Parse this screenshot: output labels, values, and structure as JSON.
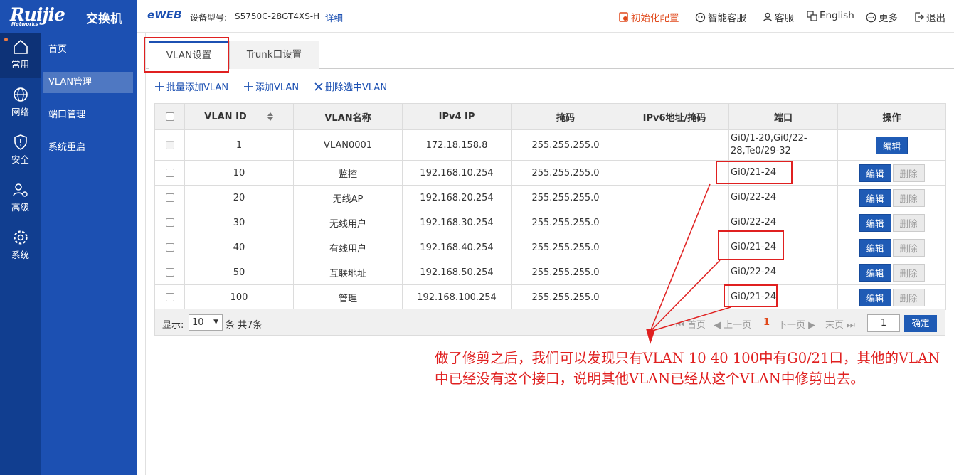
{
  "brand": {
    "logo": "Ruijie",
    "logo_sub": "Networks",
    "title": "交换机"
  },
  "header": {
    "eweb": "eWEB",
    "model_label": "设备型号:",
    "model_value": "S5750C-28GT4XS-H",
    "detail_link": "详细",
    "actions": [
      {
        "label": "初始化配置",
        "icon": "reset-icon",
        "color": "#e0491b"
      },
      {
        "label": "智能客服",
        "icon": "robot-icon"
      },
      {
        "label": "客服",
        "icon": "user-icon"
      },
      {
        "label": "English",
        "icon": "translate-icon"
      },
      {
        "label": "更多",
        "icon": "more-icon"
      },
      {
        "label": "退出",
        "icon": "logout-icon"
      }
    ]
  },
  "rail": {
    "items": [
      {
        "label": "常用",
        "icon": "home-icon"
      },
      {
        "label": "网络",
        "icon": "globe-icon"
      },
      {
        "label": "安全",
        "icon": "shield-icon"
      },
      {
        "label": "高级",
        "icon": "advanced-user-icon"
      },
      {
        "label": "系统",
        "icon": "gear-icon"
      }
    ]
  },
  "subnav": {
    "items": [
      {
        "label": "首页"
      },
      {
        "label": "VLAN管理"
      },
      {
        "label": "端口管理"
      },
      {
        "label": "系统重启"
      }
    ]
  },
  "tabs": [
    {
      "label": "VLAN设置"
    },
    {
      "label": "Trunk口设置"
    }
  ],
  "toolbar": {
    "batch_add": "批量添加VLAN",
    "add": "添加VLAN",
    "delete_selected": "删除选中VLAN"
  },
  "table": {
    "headers": [
      "VLAN ID",
      "VLAN名称",
      "IPv4 IP",
      "掩码",
      "IPv6地址/掩码",
      "端口",
      "操作"
    ],
    "rows": [
      {
        "id": "1",
        "name": "VLAN0001",
        "ip": "172.18.158.8",
        "mask": "255.255.255.0",
        "ipv6": "",
        "ports": "Gi0/1-20,Gi0/22-28,Te0/29-32"
      },
      {
        "id": "10",
        "name": "监控",
        "ip": "192.168.10.254",
        "mask": "255.255.255.0",
        "ipv6": "",
        "ports": "Gi0/21-24"
      },
      {
        "id": "20",
        "name": "无线AP",
        "ip": "192.168.20.254",
        "mask": "255.255.255.0",
        "ipv6": "",
        "ports": "Gi0/22-24"
      },
      {
        "id": "30",
        "name": "无线用户",
        "ip": "192.168.30.254",
        "mask": "255.255.255.0",
        "ipv6": "",
        "ports": "Gi0/22-24"
      },
      {
        "id": "40",
        "name": "有线用户",
        "ip": "192.168.40.254",
        "mask": "255.255.255.0",
        "ipv6": "",
        "ports": "Gi0/21-24"
      },
      {
        "id": "50",
        "name": "互联地址",
        "ip": "192.168.50.254",
        "mask": "255.255.255.0",
        "ipv6": "",
        "ports": "Gi0/22-24"
      },
      {
        "id": "100",
        "name": "管理",
        "ip": "192.168.100.254",
        "mask": "255.255.255.0",
        "ipv6": "",
        "ports": "Gi0/21-24"
      }
    ],
    "edit_label": "编辑",
    "delete_label": "删除"
  },
  "pagination": {
    "show_label": "显示:",
    "page_size": "10",
    "total": "条 共7条",
    "first": "首页",
    "prev": "上一页",
    "current": "1",
    "next": "下一页",
    "last": "末页",
    "page_input": "1",
    "confirm": "确定"
  },
  "annotation": "做了修剪之后，我们可以发现只有VLAN 10 40 100中有G0/21口，其他的VLAN中已经没有这个接口，说明其他VLAN已经从这个VLAN中修剪出去。",
  "colors": {
    "brand_blue": "#1c50b2",
    "rail_blue": "#113e90",
    "accent_red": "#e02020",
    "button_blue": "#1f5bb5"
  }
}
